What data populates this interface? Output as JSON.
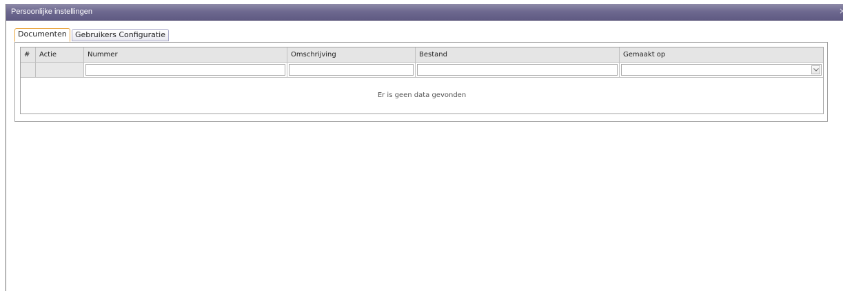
{
  "window": {
    "title": "Persoonlijke instellingen",
    "close_glyph": "×",
    "close_icon": "close-icon",
    "titlebar_color": "#6e6990"
  },
  "tabs": [
    {
      "label": "Documenten",
      "active": true
    },
    {
      "label": "Gebruikers Configuratie",
      "active": false
    }
  ],
  "grid": {
    "columns": [
      {
        "key": "index",
        "label": "#"
      },
      {
        "key": "actie",
        "label": "Actie"
      },
      {
        "key": "nummer",
        "label": "Nummer"
      },
      {
        "key": "omschrijving",
        "label": "Omschrijving"
      },
      {
        "key": "bestand",
        "label": "Bestand"
      },
      {
        "key": "gemaakt_op",
        "label": "Gemaakt op"
      }
    ],
    "filters": {
      "nummer": "",
      "omschrijving": "",
      "bestand": "",
      "gemaakt_op": ""
    },
    "rows": [],
    "empty_message": "Er is geen data gevonden"
  }
}
